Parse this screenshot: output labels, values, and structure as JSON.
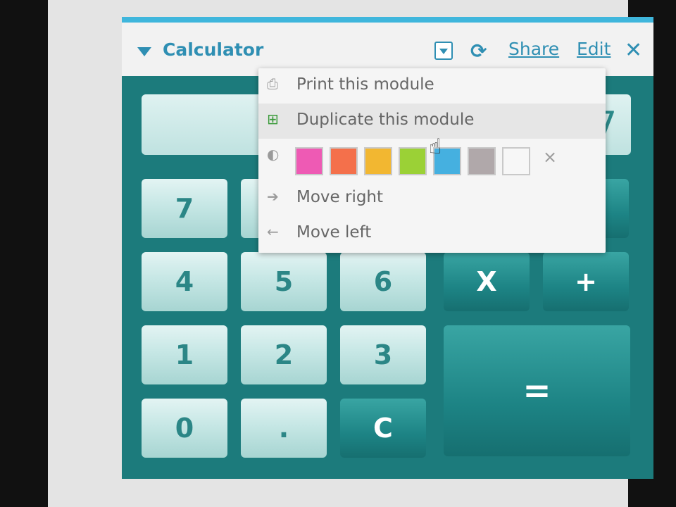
{
  "module": {
    "title": "Calculator",
    "share_label": "Share",
    "edit_label": "Edit",
    "icons": {
      "collapse": "collapse-triangle-icon",
      "menu": "dropdown-menu-icon",
      "refresh": "refresh-icon",
      "close": "close-icon"
    },
    "accent_color": "#3fb6dc"
  },
  "calculator": {
    "display_value": "7",
    "keys": {
      "k7": "7",
      "k4": "4",
      "k5": "5",
      "k6": "6",
      "k1": "1",
      "k2": "2",
      "k3": "3",
      "k0": "0",
      "dot": ".",
      "clear": "C",
      "multiply": "X",
      "plus": "+",
      "equals": "="
    },
    "body_color": "#1c7b7c"
  },
  "menu": {
    "print_label": "Print this module",
    "duplicate_label": "Duplicate this module",
    "move_right_label": "Move right",
    "move_left_label": "Move left",
    "clear_color_symbol": "×",
    "swatches": [
      "#ee5ab4",
      "#f4704b",
      "#f2b731",
      "#9bd136",
      "#45b0e0",
      "#b0a8aa",
      "#f7f7f7"
    ]
  }
}
